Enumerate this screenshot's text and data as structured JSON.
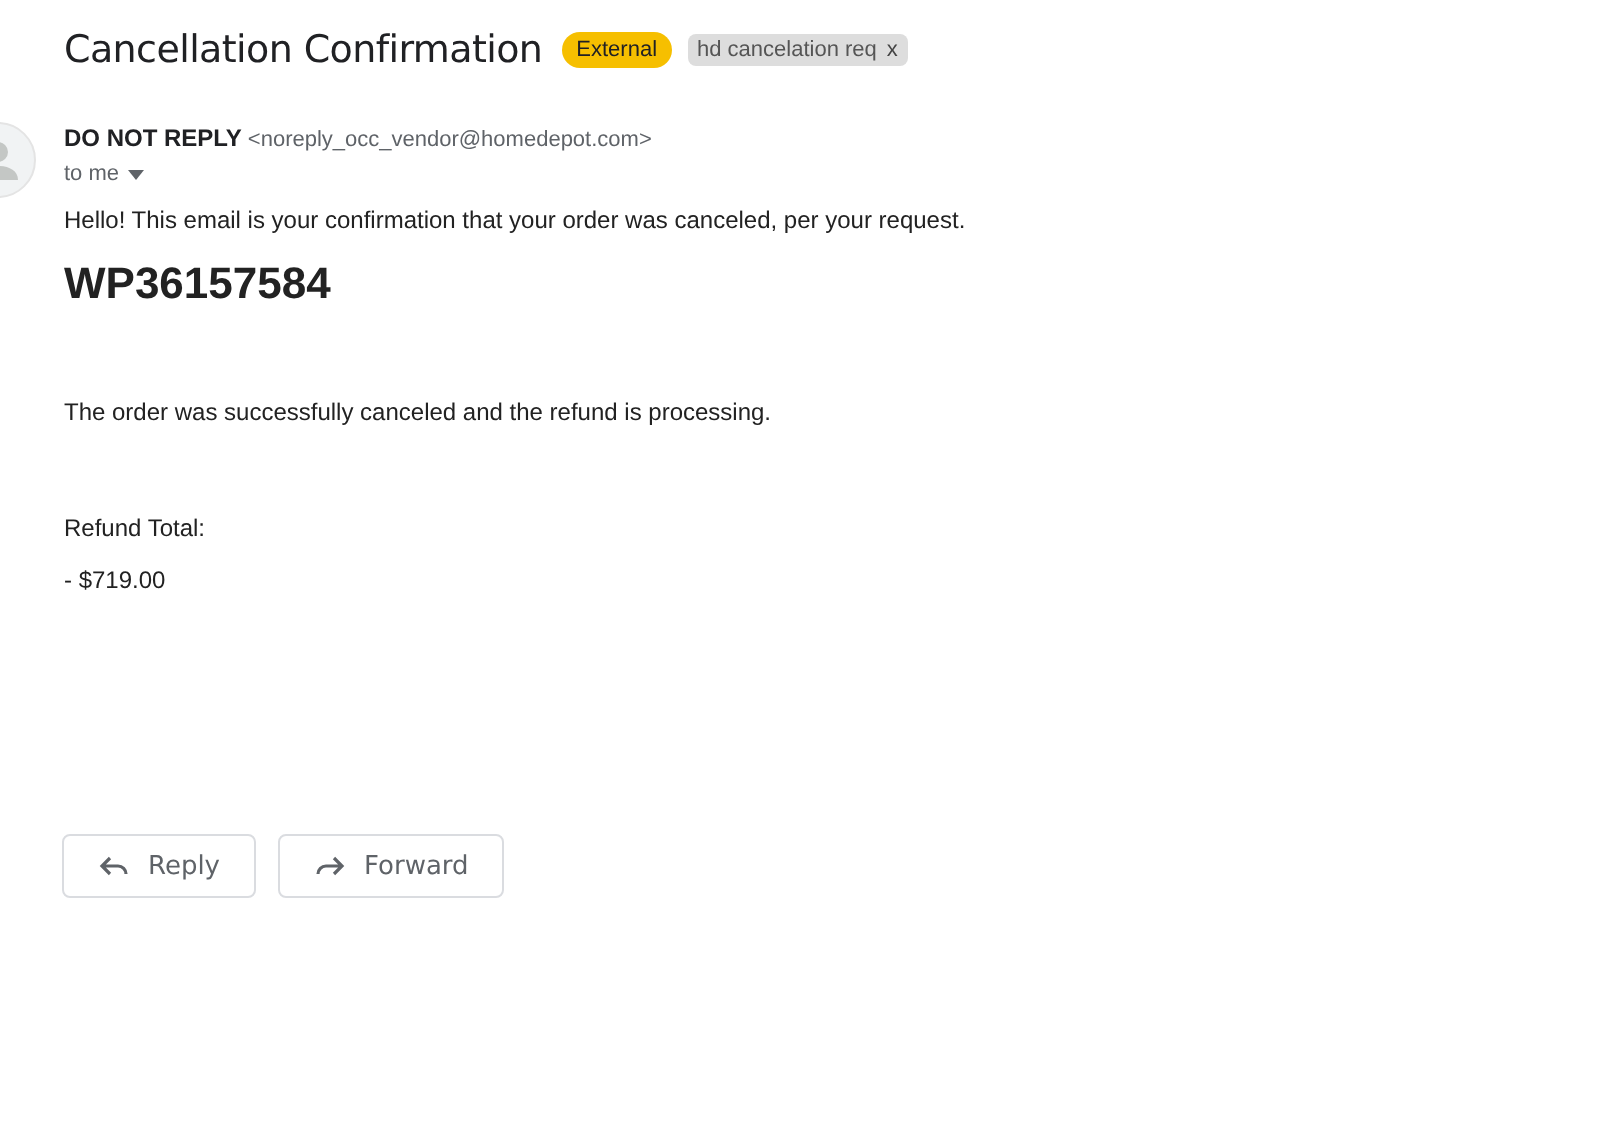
{
  "subject": "Cancellation Confirmation",
  "labels": [
    {
      "text": "External",
      "kind": "warning"
    },
    {
      "text": "hd cancelation req",
      "kind": "user",
      "remove": "x"
    }
  ],
  "sender": {
    "name": "DO NOT REPLY",
    "address": "<noreply_occ_vendor@homedepot.com>",
    "recipient": "to me"
  },
  "body": [
    {
      "kind": "text",
      "text": "Hello! This email is your confirmation that your order was canceled, per your request."
    },
    {
      "kind": "heading",
      "text": "WP36157584"
    },
    {
      "kind": "text",
      "text": "The order was successfully canceled and the refund is processing."
    },
    {
      "kind": "text",
      "text": "Refund Total:"
    },
    {
      "kind": "text",
      "text": "- $719.00"
    }
  ],
  "actions": [
    {
      "label": "Reply",
      "kind": "reply"
    },
    {
      "label": "Forward",
      "kind": "forward"
    }
  ]
}
